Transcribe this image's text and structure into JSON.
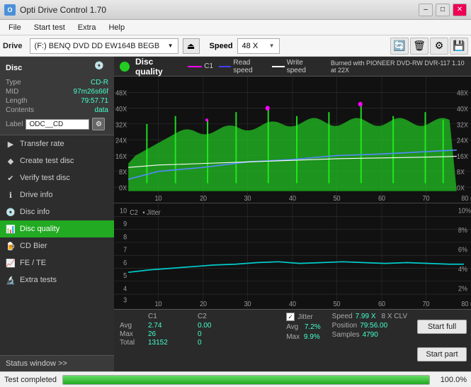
{
  "titlebar": {
    "icon_label": "O",
    "title": "Opti Drive Control 1.70",
    "min_label": "–",
    "max_label": "□",
    "close_label": "✕"
  },
  "menubar": {
    "items": [
      "File",
      "Start test",
      "Extra",
      "Help"
    ]
  },
  "drivebar": {
    "drive_label": "Drive",
    "drive_value": "(F:)  BENQ DVD DD EW164B BEGB",
    "speed_label": "Speed",
    "speed_value": "48 X"
  },
  "sidebar": {
    "disc_title": "Disc",
    "disc_type_label": "Type",
    "disc_type_value": "CD-R",
    "disc_mid_label": "MID",
    "disc_mid_value": "97m26s66f",
    "disc_length_label": "Length",
    "disc_length_value": "79:57.71",
    "disc_contents_label": "Contents",
    "disc_contents_value": "data",
    "disc_label_label": "Label",
    "disc_label_value": "ODC__CD",
    "items": [
      {
        "id": "transfer-rate",
        "label": "Transfer rate",
        "icon": "▶"
      },
      {
        "id": "create-test-disc",
        "label": "Create test disc",
        "icon": "◆"
      },
      {
        "id": "verify-test-disc",
        "label": "Verify test disc",
        "icon": "✔"
      },
      {
        "id": "drive-info",
        "label": "Drive info",
        "icon": "ℹ"
      },
      {
        "id": "disc-info",
        "label": "Disc info",
        "icon": "💿"
      },
      {
        "id": "disc-quality",
        "label": "Disc quality",
        "icon": "📊",
        "active": true
      },
      {
        "id": "cd-bier",
        "label": "CD Bier",
        "icon": "🍺"
      },
      {
        "id": "fe-te",
        "label": "FE / TE",
        "icon": "📈"
      },
      {
        "id": "extra-tests",
        "label": "Extra tests",
        "icon": "🔬"
      }
    ],
    "status_window_label": "Status window >>"
  },
  "disc_quality": {
    "title": "Disc quality",
    "legend": {
      "c1_label": "C1",
      "read_speed_label": "Read speed",
      "write_speed_label": "Write speed",
      "burned_label": "Burned with PIONEER DVD-RW  DVR-117 1.10 at 22X"
    }
  },
  "stats": {
    "columns": [
      "C1",
      "C2"
    ],
    "rows": [
      {
        "label": "Avg",
        "c1": "2.74",
        "c2": "0.00"
      },
      {
        "label": "Max",
        "c1": "26",
        "c2": "0"
      },
      {
        "label": "Total",
        "c1": "13152",
        "c2": "0"
      }
    ],
    "jitter_label": "Jitter",
    "jitter_checked": true,
    "jitter_avg": "7.2%",
    "jitter_max": "9.9%",
    "speed_label": "Speed",
    "speed_value": "7.99 X",
    "speed_mode": "8 X CLV",
    "position_label": "Position",
    "position_value": "79:56.00",
    "samples_label": "Samples",
    "samples_value": "4790"
  },
  "buttons": {
    "start_full": "Start full",
    "start_part": "Start part"
  },
  "statusbar": {
    "text": "Test completed",
    "progress": 100,
    "progress_label": "100.0%"
  }
}
